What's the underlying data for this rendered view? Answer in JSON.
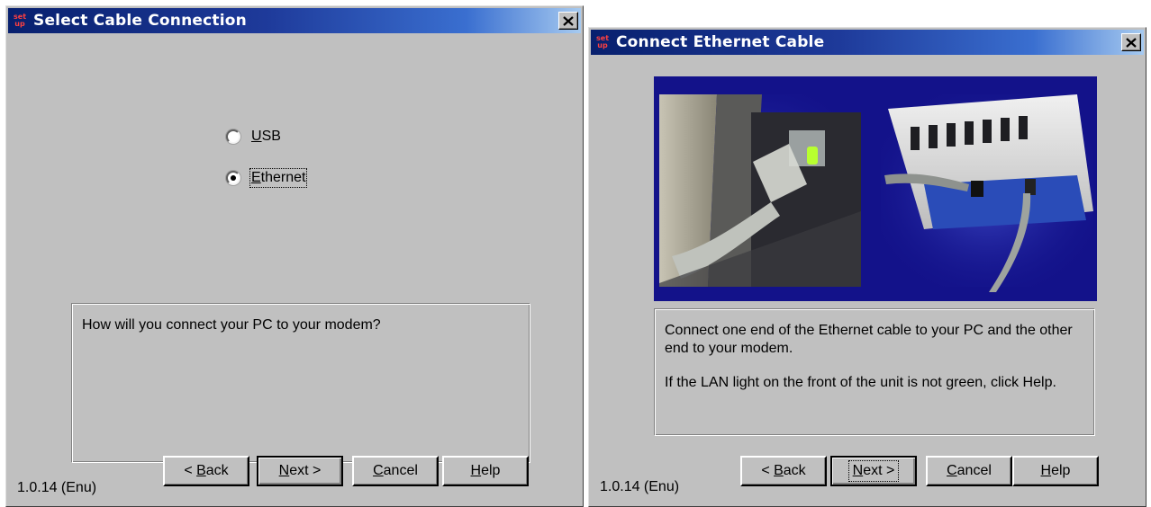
{
  "dialog1": {
    "title": "Select Cable Connection",
    "close_label": "✕",
    "options": [
      {
        "prefix": "",
        "mnemonic": "U",
        "rest": "SB",
        "checked": false
      },
      {
        "prefix": "",
        "mnemonic": "E",
        "rest": "thernet",
        "checked": true
      }
    ],
    "message": "How will you connect your PC to your modem?",
    "buttons": {
      "back": {
        "pre": "< ",
        "mnemonic": "B",
        "rest": "ack"
      },
      "next": {
        "mnemonic": "N",
        "rest": "ext >"
      },
      "cancel": {
        "mnemonic": "C",
        "rest": "ancel"
      },
      "help": {
        "mnemonic": "H",
        "rest": "elp"
      }
    },
    "version": "1.0.14 (Enu)"
  },
  "dialog2": {
    "title": "Connect Ethernet Cable",
    "close_label": "✕",
    "message_lines": [
      "Connect one end of the Ethernet cable to your PC and the other end to your modem.",
      "If the LAN light on the front of the unit is not green, click Help."
    ],
    "buttons": {
      "back": {
        "pre": "< ",
        "mnemonic": "B",
        "rest": "ack"
      },
      "next": {
        "mnemonic": "N",
        "rest": "ext >"
      },
      "cancel": {
        "mnemonic": "C",
        "rest": "ancel"
      },
      "help": {
        "mnemonic": "H",
        "rest": "elp"
      }
    },
    "version": "1.0.14 (Enu)"
  },
  "app_icon": {
    "line1": "set",
    "line2": "up"
  },
  "colors": {
    "title_start": "#08206e",
    "title_end": "#a6caf0",
    "dialog_bg": "#c0c0c0",
    "photo_bg": "#13128a"
  },
  "icons": [
    "setup-app-icon",
    "close-icon",
    "radio-icon"
  ]
}
